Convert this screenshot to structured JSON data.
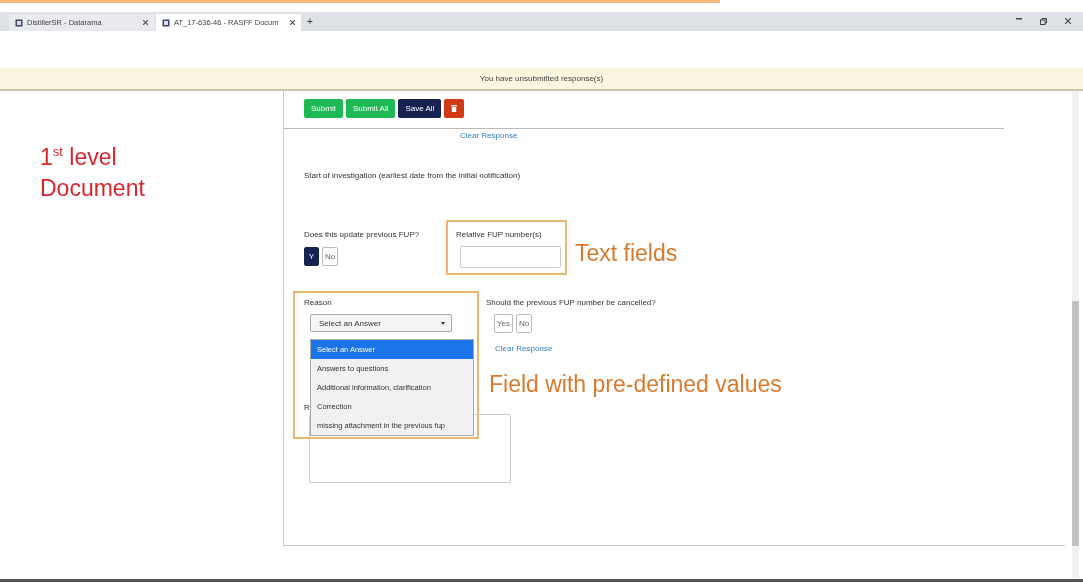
{
  "browser": {
    "tabs": [
      {
        "label": "DistillerSR - Datarama",
        "selected": false
      },
      {
        "label": "AT_17-636-46 - RASFF Docum",
        "selected": true
      }
    ],
    "new_tab": "+"
  },
  "notice": "You have unsubmitted response(s)",
  "page_title": "1$^{st}$ level Document",
  "toolbar": [
    {
      "kind": "submit",
      "label": "Submit"
    },
    {
      "kind": "submit",
      "label": "Submit All"
    },
    {
      "kind": "save",
      "label": "Save All"
    },
    {
      "kind": "delete"
    }
  ],
  "clear_response": "Clear Response",
  "investigation_question": "Start of investigation (earliest date from the initial notification)",
  "update_question": {
    "label": "Does this update previous FUP?",
    "options": [
      {
        "label": "Y",
        "selected": true
      },
      {
        "label": "No",
        "selected": false
      }
    ]
  },
  "relative_fup": {
    "label": "Relative FUP number(s)",
    "callout": "Text fields"
  },
  "reason": {
    "label": "Reason",
    "value": "Select an Answer",
    "expanded": true,
    "callout": "Field with pre-defined values",
    "options": [
      {
        "label": "Select an Answer",
        "selected": true
      },
      {
        "label": "Answers to questions",
        "selected": false
      },
      {
        "label": "Additional information, clarification",
        "selected": false
      },
      {
        "label": "Correction",
        "selected": false
      },
      {
        "label": "missing attachment in the previous fup",
        "selected": false
      }
    ]
  },
  "cancel_question": {
    "label": "Should the previous FUP number be cancelled?",
    "options": [
      {
        "label": "Yes",
        "selected": false
      },
      {
        "label": "No",
        "selected": false
      }
    ],
    "clear_response": "Clear Response"
  },
  "remarks": {
    "label": "R"
  }
}
